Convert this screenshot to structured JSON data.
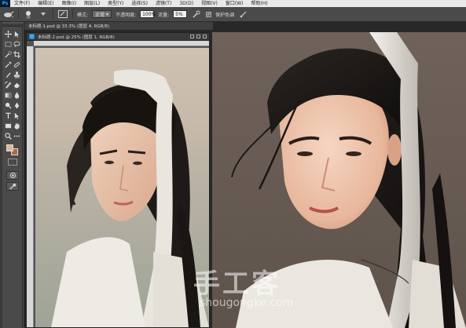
{
  "app": {
    "logo": "Ps"
  },
  "menu": {
    "items": [
      "文件(F)",
      "编辑(E)",
      "图像(I)",
      "图层(L)",
      "类型(Y)",
      "选择(S)",
      "滤镜(T)",
      "3D(D)",
      "视图(V)",
      "窗口(W)",
      "帮助(H)"
    ]
  },
  "options_bar": {
    "brush_size": "26",
    "mode_label": "模式:",
    "mode_value": "正常",
    "opacity_label": "不透明度:",
    "opacity_value": "100%",
    "flow_label": "流量:",
    "flow_value": "5%",
    "protect_label": "保护色调"
  },
  "tabs": {
    "inactive_title": "未标题-1.psd @ 33.3% (图层 4, RGB/8)"
  },
  "document": {
    "title": "未标题-2.psd @ 25% (图层 1, RGB/8)"
  },
  "tools": {
    "foreground_color": "#e6b492",
    "background_color": "#a9694a"
  },
  "watermark": {
    "logo": "手工客",
    "url": "shougongke.com"
  }
}
